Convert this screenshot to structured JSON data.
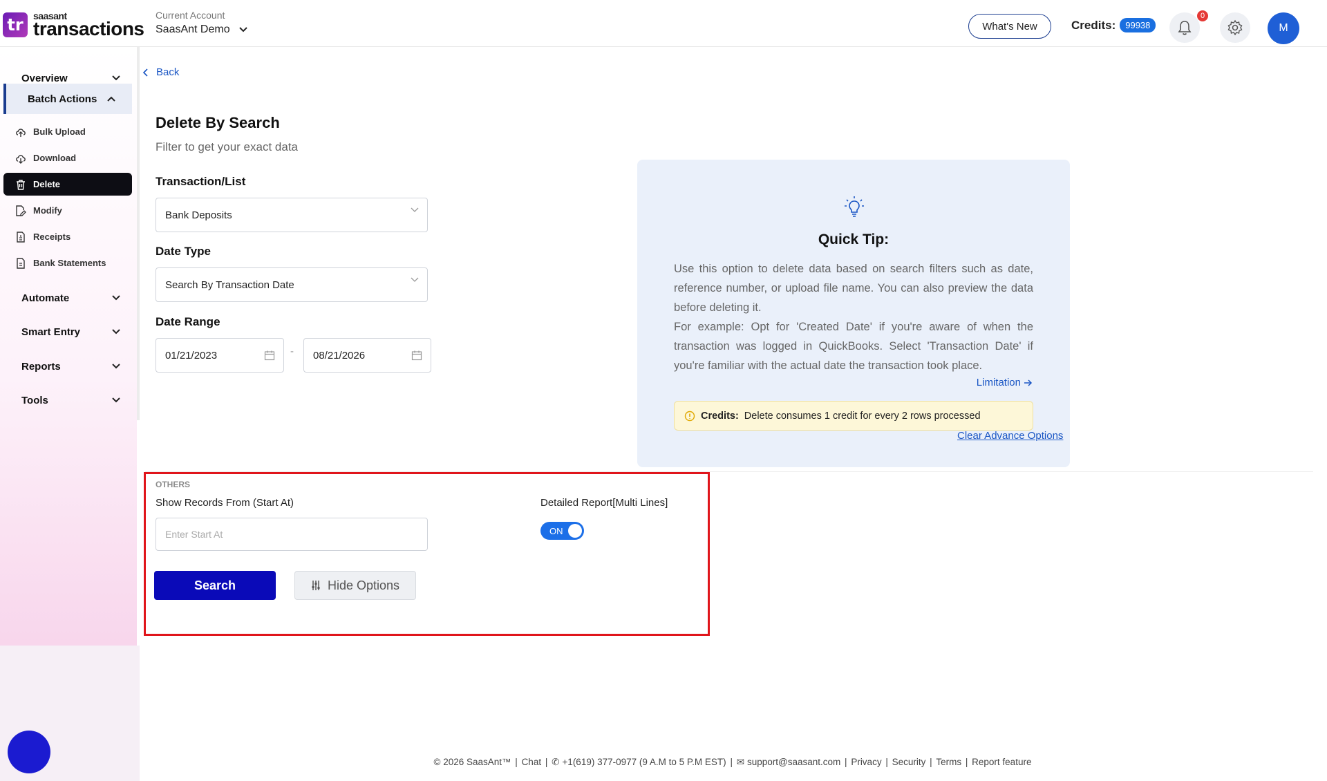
{
  "header": {
    "logo_small": "saasant",
    "logo_big": "transactions",
    "logo_mark": "tr",
    "account_label": "Current Account",
    "account_value": "SaasAnt Demo",
    "whats_new": "What's New",
    "credits_label": "Credits:",
    "credits_value": "99938",
    "notifications_count": "0",
    "avatar_initial": "M"
  },
  "sidebar": {
    "sections": [
      {
        "label": "Overview"
      },
      {
        "label": "Batch Actions"
      },
      {
        "label": "Automate"
      },
      {
        "label": "Smart Entry"
      },
      {
        "label": "Reports"
      },
      {
        "label": "Tools"
      }
    ],
    "batch_items": [
      {
        "label": "Bulk Upload",
        "icon": "upload-cloud-icon"
      },
      {
        "label": "Download",
        "icon": "download-cloud-icon"
      },
      {
        "label": "Delete",
        "icon": "trash-icon"
      },
      {
        "label": "Modify",
        "icon": "edit-file-icon"
      },
      {
        "label": "Receipts",
        "icon": "receipt-icon"
      },
      {
        "label": "Bank Statements",
        "icon": "statement-icon"
      }
    ]
  },
  "main": {
    "back_label": "Back",
    "title": "Delete By Search",
    "subtitle": "Filter to get your exact data",
    "transaction_label": "Transaction/List",
    "transaction_value": "Bank Deposits",
    "date_type_label": "Date Type",
    "date_type_value": "Search By Transaction Date",
    "date_range_label": "Date Range",
    "date_from": "01/21/2023",
    "date_separator": "-",
    "date_to": "08/21/2026",
    "clear_advance": "Clear Advance Options"
  },
  "tip": {
    "title": "Quick Tip:",
    "body1": "Use this option to delete data based on search filters such as date, reference number, or upload file name. You can also preview the data before deleting it.",
    "body2": "For example: Opt for 'Created Date' if you're aware of when the transaction was logged in QuickBooks. Select 'Transaction Date' if you're familiar with the actual date the transaction took place.",
    "limitation": "Limitation",
    "credits_bold": "Credits:",
    "credits_text": "Delete consumes 1 credit for every 2 rows processed"
  },
  "others": {
    "heading": "OTHERS",
    "start_label": "Show Records From (Start At)",
    "start_placeholder": "Enter Start At",
    "detail_label": "Detailed Report[Multi Lines]",
    "toggle_label": "ON",
    "search_label": "Search",
    "hide_label": "Hide Options"
  },
  "footer": {
    "copyright": "© 2026 SaasAnt™",
    "chat": "Chat",
    "phone": "+1(619) 377-0977 (9 A.M to 5 P.M EST)",
    "email": "support@saasant.com",
    "privacy": "Privacy",
    "security": "Security",
    "terms": "Terms",
    "report": "Report feature"
  },
  "colors": {
    "accent": "#1a3c8f",
    "primary_button": "#0a0ab8",
    "highlight_box": "#e0151b",
    "tip_bg": "#eaf0fa"
  }
}
